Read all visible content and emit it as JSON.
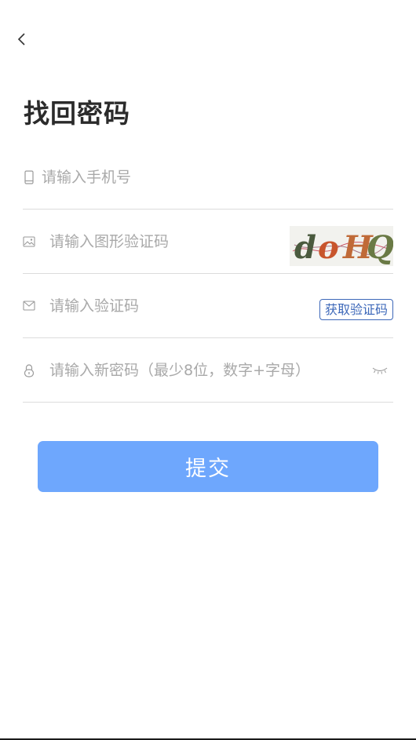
{
  "header": {
    "back_icon": "chevron-left-icon"
  },
  "title": "找回密码",
  "form": {
    "phone": {
      "placeholder": "请输入手机号",
      "icon": "phone-icon"
    },
    "captcha": {
      "placeholder": "请输入图形验证码",
      "icon": "image-icon",
      "captcha_text": "doHQ"
    },
    "sms_code": {
      "placeholder": "请输入验证码",
      "icon": "mail-icon",
      "get_code_label": "获取验证码"
    },
    "password": {
      "placeholder": "请输入新密码（最少8位，数字+字母）",
      "icon": "lock-icon",
      "toggle_icon": "eye-closed-icon"
    }
  },
  "submit_label": "提交",
  "colors": {
    "accent": "#3d68b9",
    "submit_bg": "#6ea7fd",
    "divider": "#dcdcdc",
    "placeholder": "#a9a9a9"
  }
}
